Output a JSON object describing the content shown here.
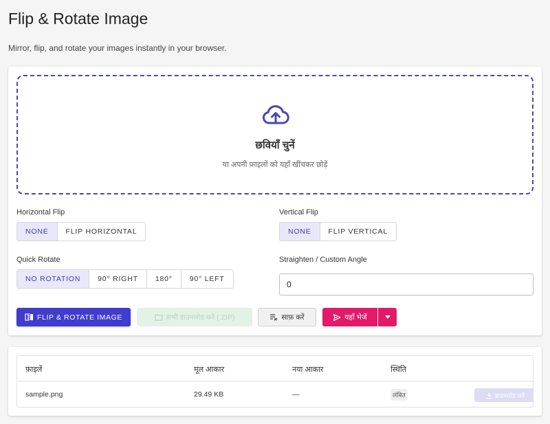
{
  "page": {
    "title": "Flip & Rotate Image",
    "subtitle": "Mirror, flip, and rotate your images instantly in your browser."
  },
  "dropzone": {
    "title": "छवियाँ चुनें",
    "subtitle": "या अपनी फ़ाइलों को यहाँ खींचकर छोड़ें"
  },
  "horizontal_flip": {
    "label": "Horizontal Flip",
    "options": [
      "NONE",
      "FLIP HORIZONTAL"
    ],
    "selected": "NONE"
  },
  "vertical_flip": {
    "label": "Vertical Flip",
    "options": [
      "NONE",
      "FLIP VERTICAL"
    ],
    "selected": "NONE"
  },
  "quick_rotate": {
    "label": "Quick Rotate",
    "options": [
      "NO ROTATION",
      "90° RIGHT",
      "180°",
      "90° LEFT"
    ],
    "selected": "NO ROTATION"
  },
  "custom_angle": {
    "label": "Straighten / Custom Angle",
    "value": "0"
  },
  "actions": {
    "primary": "FLIP & ROTATE IMAGE",
    "download_all": "सभी डाउनलोड करें (.ZIP)",
    "clear": "साफ़ करें",
    "send": "यहाँ भेजें"
  },
  "files_table": {
    "headers": [
      "फ़ाइलें",
      "मूल आकार",
      "नया आकार",
      "स्थिति"
    ],
    "rows": [
      {
        "name": "sample.png",
        "original_size": "29.49 KB",
        "new_size": "—",
        "status": "लंबित",
        "action": "डाउनलोड करें"
      }
    ]
  },
  "colors": {
    "accent": "#3f3cce",
    "dropzone_border": "#4a45b5",
    "send": "#e3196a",
    "selected_bg": "#e8e8fa"
  }
}
